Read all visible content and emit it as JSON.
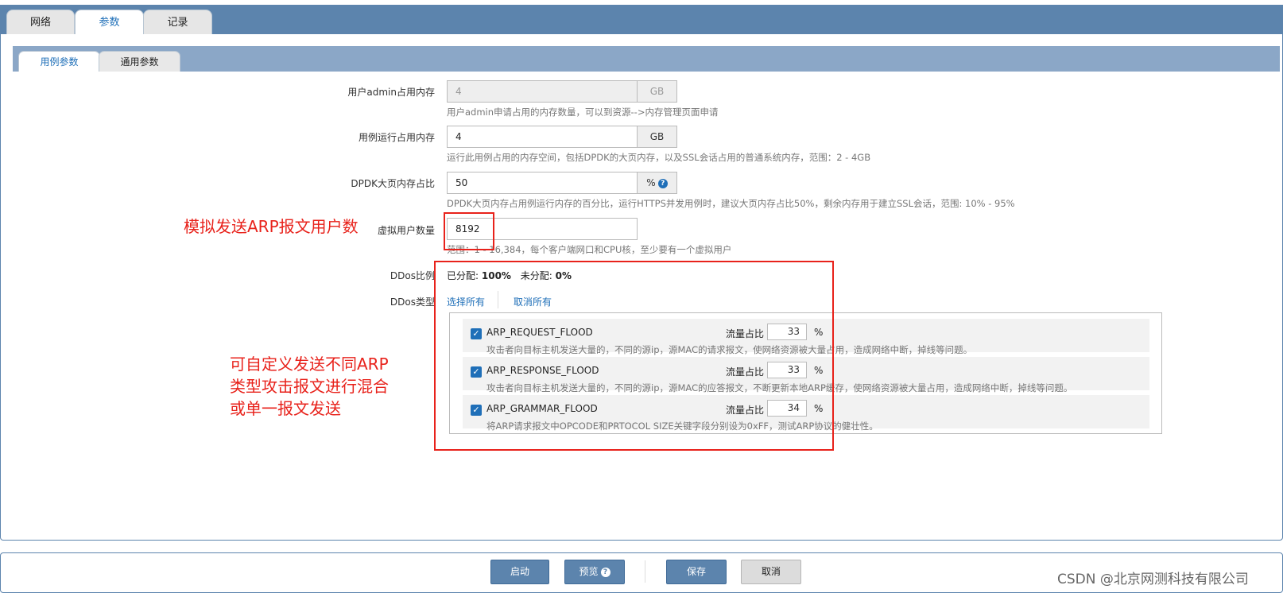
{
  "top_tabs": [
    {
      "label": "网络",
      "active": false
    },
    {
      "label": "参数",
      "active": true
    },
    {
      "label": "记录",
      "active": false
    }
  ],
  "sub_tabs": [
    {
      "label": "用例参数",
      "active": true
    },
    {
      "label": "通用参数",
      "active": false
    }
  ],
  "form": {
    "admin_mem": {
      "label": "用户admin占用内存",
      "value": "4",
      "unit": "GB",
      "help": "用户admin申请占用的内存数量，可以到资源-->内存管理页面申请"
    },
    "case_mem": {
      "label": "用例运行占用内存",
      "value": "4",
      "unit": "GB",
      "help": "运行此用例占用的内存空间，包括DPDK的大页内存，以及SSL会话占用的普通系统内存，范围：2 - 4GB"
    },
    "dpdk_ratio": {
      "label": "DPDK大页内存占比",
      "value": "50",
      "unit": "%",
      "help_icon": "question-circle-icon",
      "help": "DPDK大页内存占用例运行内存的百分比，运行HTTPS并发用例时，建议大页内存占比50%，剩余内存用于建立SSL会话，范围: 10% - 95%"
    },
    "virtual_users": {
      "label": "虚拟用户数量",
      "value": "8192",
      "help": "范围：1 - 16,384，每个客户端网口和CPU核，至少要有一个虚拟用户"
    },
    "ddos_ratio": {
      "label": "DDos比例",
      "allocated_label": "已分配:",
      "allocated_value": "100%",
      "unallocated_label": "未分配:",
      "unallocated_value": "0%"
    },
    "ddos_type": {
      "label": "DDos类型",
      "select_all": "选择所有",
      "deselect_all": "取消所有"
    }
  },
  "ddos_items": [
    {
      "name": "ARP_REQUEST_FLOOD",
      "checked": true,
      "ratio_label": "流量占比",
      "ratio": "33",
      "unit": "%",
      "desc": "攻击者向目标主机发送大量的，不同的源ip，源MAC的请求报文，使网络资源被大量占用，造成网络中断，掉线等问题。"
    },
    {
      "name": "ARP_RESPONSE_FLOOD",
      "checked": true,
      "ratio_label": "流量占比",
      "ratio": "33",
      "unit": "%",
      "desc": "攻击者向目标主机发送大量的，不同的源ip，源MAC的应答报文，不断更新本地ARP缓存，使网络资源被大量占用，造成网络中断，掉线等问题。"
    },
    {
      "name": "ARP_GRAMMAR_FLOOD",
      "checked": true,
      "ratio_label": "流量占比",
      "ratio": "34",
      "unit": "%",
      "desc": "将ARP请求报文中OPCODE和PRTOCOL SIZE关键字段分别设为0xFF，测试ARP协议的健壮性。"
    }
  ],
  "annotations": {
    "note1": "模拟发送ARP报文用户数",
    "note2_lines": [
      "可自定义发送不同ARP",
      "类型攻击报文进行混合",
      "或单一报文发送"
    ],
    "color": "#e8221b"
  },
  "footer": {
    "start": "启动",
    "preview": "预览",
    "save": "保存",
    "cancel": "取消"
  },
  "watermark": "CSDN @北京网测科技有限公司",
  "colors": {
    "accent": "#5c84ad",
    "link": "#1f6fb8"
  }
}
